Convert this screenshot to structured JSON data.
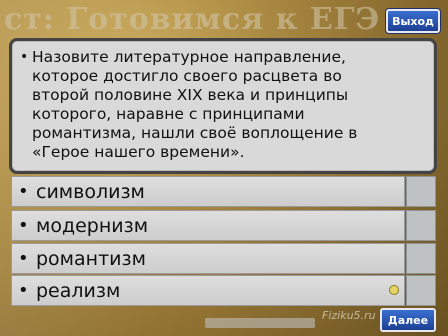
{
  "header": {
    "title": "ст: Готовимся к ЕГЭ"
  },
  "exit_button": {
    "label": "Выход"
  },
  "question": {
    "bullet": "•",
    "text": "Назовите литературное направление,\nкоторое достигло своего расцвета во\nвторой половине XIX века и принципы\nкоторого, наравне с принципами\nромантизма, нашли своё воплощение в\n«Герое нашего времени»."
  },
  "answers": [
    {
      "label": "символизм"
    },
    {
      "label": "модернизм"
    },
    {
      "label": "романтизм"
    },
    {
      "label": "реализм"
    }
  ],
  "footer": {
    "watermark": "Fiziku5.ru",
    "next_label": "Далее"
  },
  "colors": {
    "button_blue": "#1c3f93",
    "indicator": "#e7d466"
  }
}
